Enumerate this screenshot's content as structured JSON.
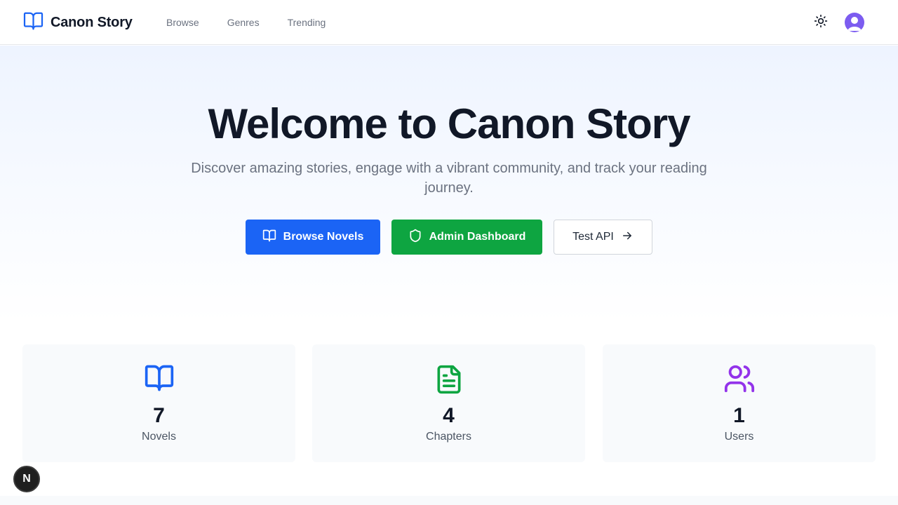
{
  "header": {
    "brand": "Canon Story",
    "nav": [
      "Browse",
      "Genres",
      "Trending"
    ]
  },
  "hero": {
    "title": "Welcome to Canon Story",
    "subtitle": "Discover amazing stories, engage with a vibrant community, and track your reading journey.",
    "buttons": {
      "browse": "Browse Novels",
      "admin": "Admin Dashboard",
      "api": "Test API"
    }
  },
  "stats": [
    {
      "value": "7",
      "label": "Novels",
      "icon": "book-open-icon",
      "color": "#1b64f5"
    },
    {
      "value": "4",
      "label": "Chapters",
      "icon": "file-text-icon",
      "color": "#0ea541"
    },
    {
      "value": "1",
      "label": "Users",
      "icon": "users-icon",
      "color": "#9333ea"
    }
  ],
  "badge": {
    "letter": "N"
  },
  "colors": {
    "primary": "#1b64f5",
    "success": "#0ea541",
    "accent": "#9333ea",
    "avatar": "#7c5cf0"
  }
}
